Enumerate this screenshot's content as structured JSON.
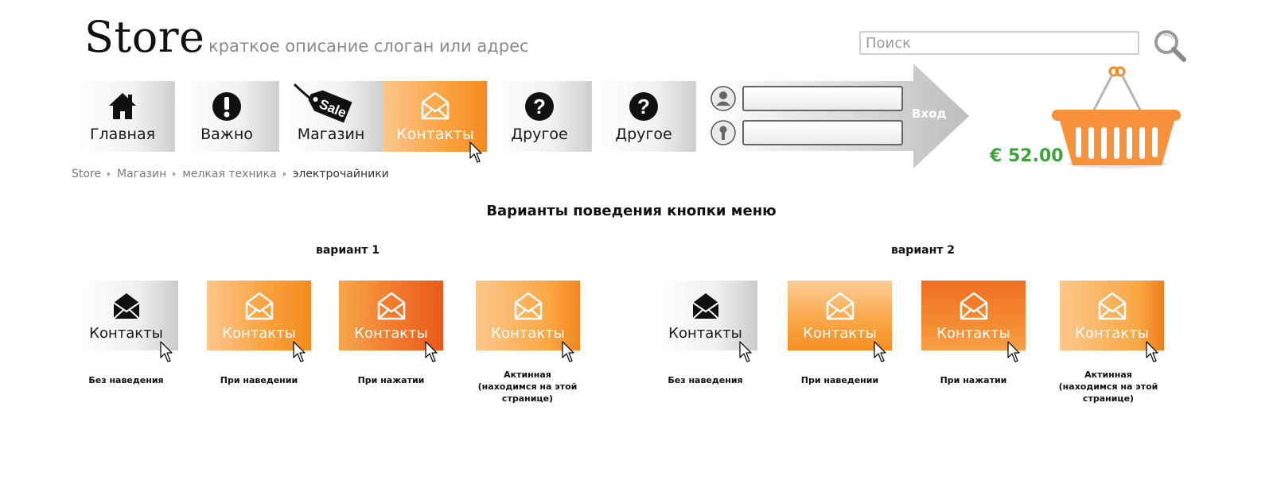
{
  "header": {
    "logo": "Store",
    "tagline": "краткое описание слоган или адрес",
    "search_placeholder": "Поиск"
  },
  "nav": {
    "items": [
      {
        "label": "Главная",
        "icon": "home-icon",
        "state": "normal"
      },
      {
        "label": "Важно",
        "icon": "exclamation-icon",
        "state": "normal"
      },
      {
        "label": "Магазин",
        "icon": "sale-tag-icon",
        "icon_text": "Sale",
        "state": "normal"
      },
      {
        "label": "Контакты",
        "icon": "envelope-icon",
        "state": "active"
      },
      {
        "label": "Другое",
        "icon": "question-icon",
        "state": "normal"
      },
      {
        "label": "Другое",
        "icon": "question-icon",
        "state": "normal"
      }
    ]
  },
  "login": {
    "username_value": "",
    "password_value": "",
    "button_label": "Вход"
  },
  "cart": {
    "total": "€ 52.00",
    "icon": "basket-icon"
  },
  "breadcrumb": {
    "items": [
      "Store",
      "Магазин",
      "мелкая техника",
      "электрочайники"
    ]
  },
  "section": {
    "title": "Варианты поведения кнопки меню",
    "variants": [
      {
        "title": "вариант 1",
        "buttons": [
          {
            "label": "Контакты",
            "state": "normal",
            "caption": "Без наведения"
          },
          {
            "label": "Контакты",
            "state": "hover",
            "caption": "При наведении"
          },
          {
            "label": "Контакты",
            "state": "pressed",
            "caption": "При нажатии"
          },
          {
            "label": "Контакты",
            "state": "active",
            "caption_line1": "Актинная",
            "caption_line2": "(находимся на этой странице)"
          }
        ]
      },
      {
        "title": "вариант 2",
        "buttons": [
          {
            "label": "Контакты",
            "state": "normal",
            "caption": "Без наведения"
          },
          {
            "label": "Контакты",
            "state": "hover",
            "caption": "При наведении"
          },
          {
            "label": "Контакты",
            "state": "pressed",
            "caption": "При нажатии"
          },
          {
            "label": "Контакты",
            "state": "active",
            "caption_line1": "Актинная",
            "caption_line2": "(находимся на этой странице)"
          }
        ]
      }
    ]
  },
  "colors": {
    "accent_orange": "#f9a03b",
    "pressed_orange": "#e85b1a",
    "price_green": "#3da33a",
    "arrow_gray": "#c8c8ca"
  }
}
